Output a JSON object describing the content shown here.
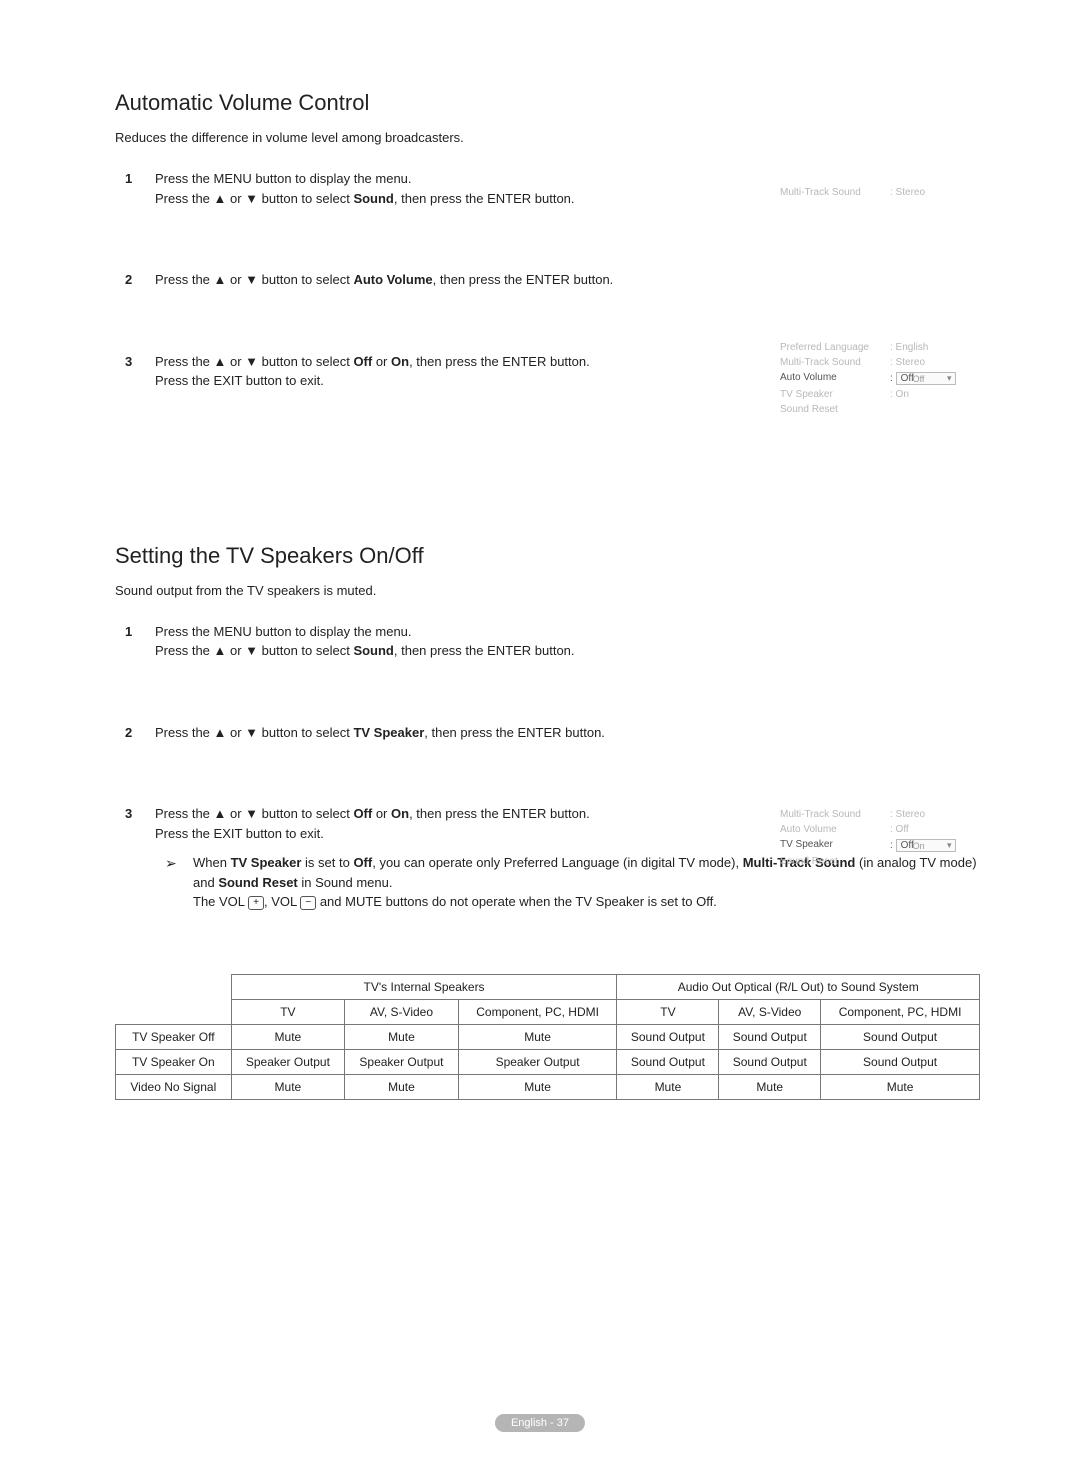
{
  "section1": {
    "title": "Automatic Volume Control",
    "intro": "Reduces the difference in volume level among broadcasters.",
    "steps": [
      {
        "line1": "Press the MENU button to display the menu.",
        "line2a": "Press the ▲ or ▼ button to select ",
        "line2b": "Sound",
        "line2c": ", then press the ENTER button."
      },
      {
        "line1a": "Press the ▲ or ▼ button to select ",
        "line1b": "Auto Volume",
        "line1c": ", then press the ENTER button."
      },
      {
        "line1a": "Press the ▲ or ▼ button to select ",
        "line1b": "Off",
        "line1c": " or ",
        "line1d": "On",
        "line1e": ", then press the ENTER button.",
        "line2": "Press the EXIT button to exit."
      }
    ]
  },
  "osd1": {
    "rows": [
      {
        "label": "Multi-Track Sound",
        "val": ": Stereo"
      }
    ]
  },
  "osd2": {
    "rows": [
      {
        "label": "Preferred Language",
        "val": ": English"
      },
      {
        "label": "Multi-Track Sound",
        "val": ": Stereo"
      },
      {
        "label": "Auto Volume",
        "val": "Off",
        "dropdown_overlap": "Off",
        "active": true,
        "dropdown": true
      },
      {
        "label": "TV Speaker",
        "val": ": On"
      },
      {
        "label": "Sound Reset",
        "val": ""
      }
    ]
  },
  "section2": {
    "title": "Setting the TV Speakers On/Off",
    "intro": "Sound output from the TV speakers is muted.",
    "steps": [
      {
        "line1": "Press the MENU button to display the menu.",
        "line2a": "Press the ▲ or ▼ button to select ",
        "line2b": "Sound",
        "line2c": ", then press the ENTER button."
      },
      {
        "line1a": "Press the ▲ or ▼ button to select ",
        "line1b": "TV Speaker",
        "line1c": ", then press the ENTER button."
      },
      {
        "line1a": "Press the ▲ or ▼ button to select ",
        "line1b": "Off",
        "line1c": " or ",
        "line1d": "On",
        "line1e": ", then press the ENTER button.",
        "line2": "Press the EXIT button to exit.",
        "note1a": "When ",
        "note1b": "TV Speaker",
        "note1c": " is set to ",
        "note1d": "Off",
        "note1e": ", you can operate only Preferred Language (in digital TV mode), ",
        "note1f": "Multi-Track Sound",
        "note1g": " (in analog TV mode) and ",
        "note1h": "Sound Reset",
        "note1i": " in Sound menu.",
        "note2a": "The VOL ",
        "note2plus": "+",
        "note2b": ", VOL ",
        "note2minus": "−",
        "note2c": " and MUTE buttons do not operate when the TV Speaker is set to Off."
      }
    ]
  },
  "osd3": {
    "rows": [
      {
        "label": "Multi-Track Sound",
        "val": ": Stereo"
      },
      {
        "label": "Auto Volume",
        "val": ": Off"
      },
      {
        "label": "TV Speaker",
        "val": "Off",
        "dropdown_overlap": "On",
        "active": true,
        "dropdown": true
      },
      {
        "label": "Sound Reset",
        "val": ""
      }
    ]
  },
  "table": {
    "header_group1": "TV's Internal Speakers",
    "header_group2": "Audio Out Optical (R/L Out) to Sound System",
    "sub_headers": [
      "TV",
      "AV, S-Video",
      "Component, PC, HDMI",
      "TV",
      "AV, S-Video",
      "Component, PC, HDMI"
    ],
    "rows": [
      {
        "label": "TV Speaker Off",
        "cells": [
          "Mute",
          "Mute",
          "Mute",
          "Sound Output",
          "Sound Output",
          "Sound Output"
        ]
      },
      {
        "label": "TV Speaker On",
        "cells": [
          "Speaker Output",
          "Speaker Output",
          "Speaker Output",
          "Sound Output",
          "Sound Output",
          "Sound Output"
        ]
      },
      {
        "label": "Video No Signal",
        "cells": [
          "Mute",
          "Mute",
          "Mute",
          "Mute",
          "Mute",
          "Mute"
        ]
      }
    ]
  },
  "footer": "English - 37"
}
